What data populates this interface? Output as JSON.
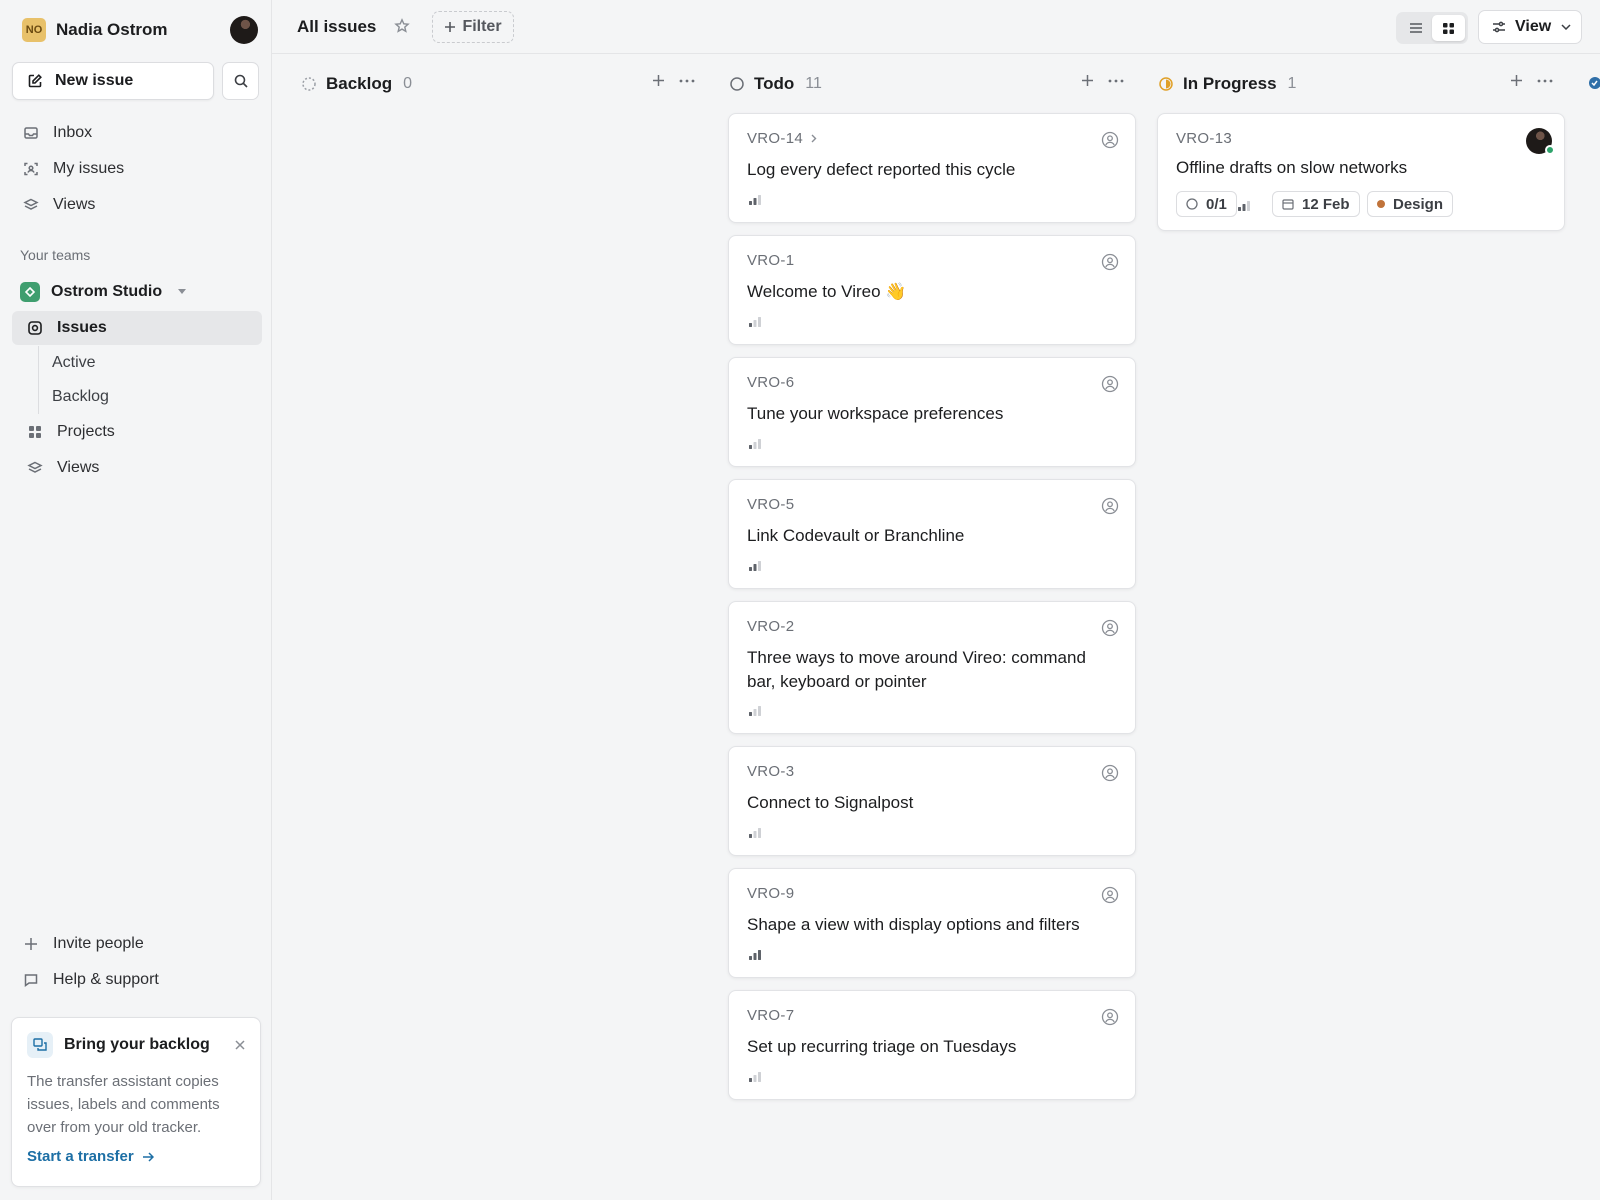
{
  "workspace": {
    "initials": "NO",
    "name": "Nadia Ostrom"
  },
  "sidebar": {
    "new_issue_label": "New issue",
    "nav": [
      {
        "label": "Inbox",
        "icon": "inbox-icon"
      },
      {
        "label": "My issues",
        "icon": "my-issues-icon"
      },
      {
        "label": "Views",
        "icon": "layers-icon"
      }
    ],
    "teams_label": "Your teams",
    "team": {
      "name": "Ostrom Studio",
      "items": [
        {
          "label": "Issues",
          "active": true
        },
        {
          "label": "Active"
        },
        {
          "label": "Backlog"
        },
        {
          "label": "Projects"
        },
        {
          "label": "Views"
        }
      ]
    },
    "footer": [
      {
        "label": "Invite people",
        "icon": "plus-icon"
      },
      {
        "label": "Help & support",
        "icon": "chat-icon"
      }
    ],
    "promo": {
      "title": "Bring your backlog",
      "text": "The transfer assistant copies issues, labels and comments over from your old tracker.",
      "link": "Start a transfer"
    }
  },
  "topbar": {
    "title": "All issues",
    "filter_label": "Filter",
    "view_label": "View"
  },
  "board": {
    "columns": [
      {
        "title": "Backlog",
        "count": "0"
      },
      {
        "title": "Todo",
        "count": "11"
      },
      {
        "title": "In Progress",
        "count": "1"
      }
    ],
    "todo_cards": [
      {
        "id": "VRO-14",
        "title": "Log every defect reported this cycle",
        "has_children": true
      },
      {
        "id": "VRO-1",
        "title": "Welcome to Vireo 👋"
      },
      {
        "id": "VRO-6",
        "title": "Tune your workspace preferences"
      },
      {
        "id": "VRO-5",
        "title": "Link Codevault or Branchline"
      },
      {
        "id": "VRO-2",
        "title": "Three ways to move around Vireo: command bar, keyboard or pointer"
      },
      {
        "id": "VRO-3",
        "title": "Connect to Signalpost"
      },
      {
        "id": "VRO-9",
        "title": "Shape a view with display options and filters"
      },
      {
        "id": "VRO-7",
        "title": "Set up recurring triage on Tuesdays"
      }
    ],
    "in_progress_cards": [
      {
        "id": "VRO-13",
        "title": "Offline drafts on slow networks",
        "subissues": "0/1",
        "due": "12 Feb",
        "label": "Design",
        "label_color": "#c0733a"
      }
    ]
  },
  "colors": {
    "accent_link": "#1d6fa5",
    "in_progress": "#e0a028",
    "team_badge": "#3f9e6f",
    "workspace_badge": "#e8c16a"
  }
}
